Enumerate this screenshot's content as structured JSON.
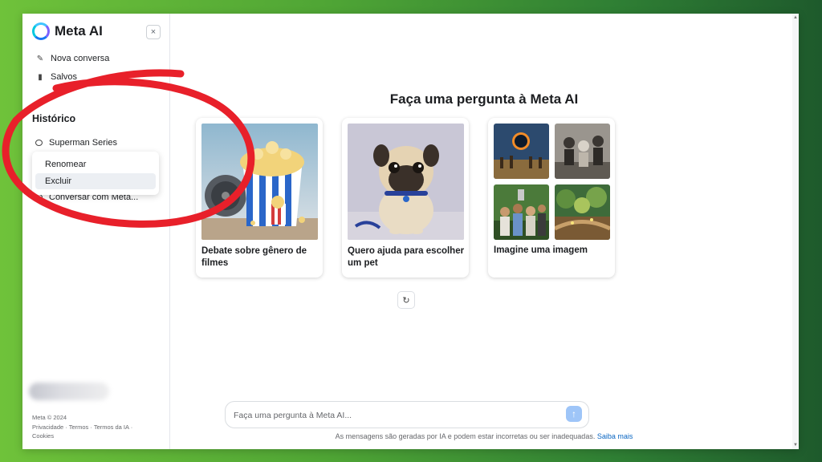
{
  "app": {
    "name": "Meta AI",
    "close_label": "×"
  },
  "sidebar": {
    "nav": [
      {
        "label": "Nova conversa",
        "icon": "edit-icon"
      },
      {
        "label": "Salvos",
        "icon": "bookmark-icon"
      }
    ],
    "history_title": "Histórico",
    "history": [
      {
        "label": "Superman Series"
      },
      {
        "label": "Conversar com Meta..."
      }
    ],
    "context_menu": {
      "rename": "Renomear",
      "delete": "Excluir"
    },
    "footer": {
      "copyright": "Meta © 2024",
      "links_line1": "Privacidade · Termos · Termos da IA ·",
      "links_line2": "Cookies"
    }
  },
  "main": {
    "title": "Faça uma pergunta à Meta AI",
    "cards": [
      {
        "caption": "Debate sobre gênero de filmes"
      },
      {
        "caption": "Quero ajuda para escolher um pet"
      },
      {
        "caption": "Imagine uma imagem"
      }
    ],
    "refresh_icon": "↻",
    "input": {
      "placeholder": "Faça uma pergunta à Meta AI...",
      "value": ""
    },
    "send_icon": "↑",
    "disclaimer": "As mensagens são geradas por IA e podem estar incorretas ou ser inadequadas.",
    "disclaimer_link": "Saiba mais"
  },
  "colors": {
    "accent": "#1877f2",
    "send_button": "#9ec5f8",
    "annotation_circle": "#e8202a",
    "background_green": "#4fa535"
  }
}
